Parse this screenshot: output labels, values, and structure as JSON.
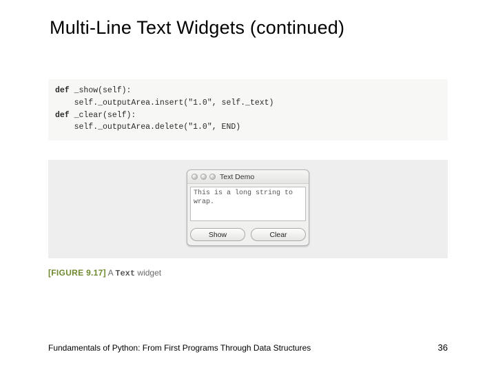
{
  "title": "Multi-Line Text Widgets (continued)",
  "code": {
    "l1a": "def",
    "l1b": " _show(self):",
    "l2": "    self._outputArea.insert(\"1.0\", self._text)",
    "l3": "",
    "l4a": "def",
    "l4b": " _clear(self):",
    "l5": "    self._outputArea.delete(\"1.0\", END)"
  },
  "demo": {
    "window_title": "Text Demo",
    "textarea_value": "This is a long string to wrap.",
    "show_label": "Show",
    "clear_label": "Clear"
  },
  "figure": {
    "tag": "[FIGURE 9.17]",
    "pre": " A ",
    "code": "Text",
    "post": " widget"
  },
  "footer": {
    "book": "Fundamentals of Python: From First Programs Through Data Structures",
    "page": "36"
  }
}
